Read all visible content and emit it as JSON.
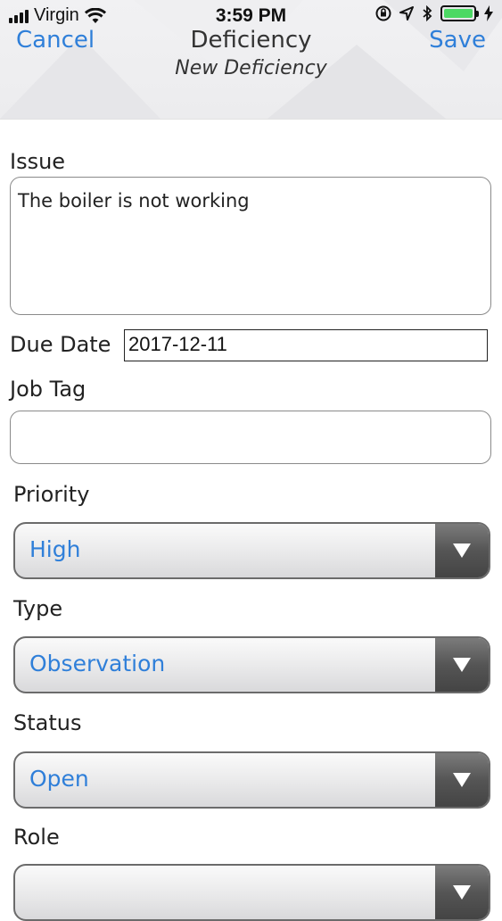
{
  "status_bar": {
    "carrier": "Virgin",
    "time": "3:59 PM"
  },
  "nav": {
    "cancel_label": "Cancel",
    "title": "Deficiency",
    "subtitle": "New Deficiency",
    "save_label": "Save"
  },
  "form": {
    "issue_label": "Issue",
    "issue_value": "The boiler is not working",
    "due_date_label": "Due Date",
    "due_date_value": "2017-12-11",
    "job_tag_label": "Job Tag",
    "job_tag_value": "",
    "priority_label": "Priority",
    "priority_value": "High",
    "type_label": "Type",
    "type_value": "Observation",
    "status_label": "Status",
    "status_value": "Open",
    "role_label": "Role",
    "role_value": ""
  },
  "colors": {
    "accent": "#2f7fd9",
    "battery": "#4cd964"
  },
  "icons": [
    "wifi-icon",
    "orientation-lock-icon",
    "location-icon",
    "bluetooth-icon",
    "battery-icon",
    "charging-icon",
    "dropdown-arrow-icon"
  ]
}
